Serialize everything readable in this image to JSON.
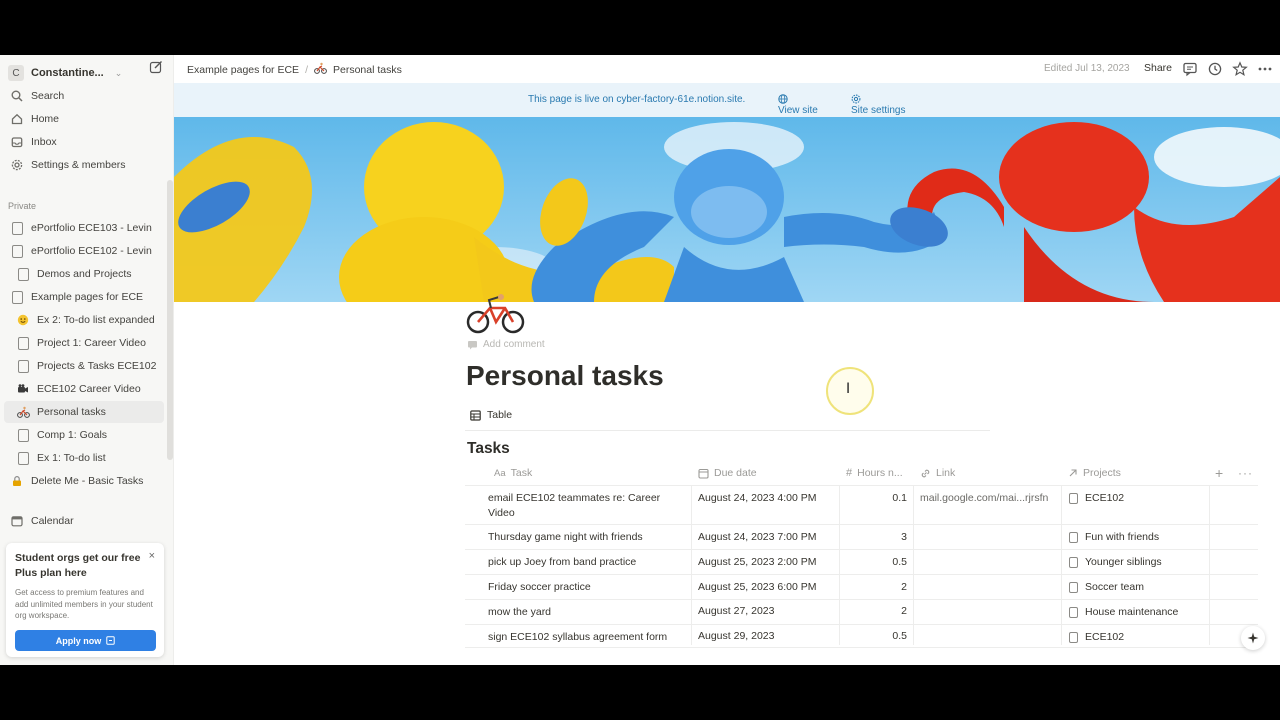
{
  "workspace": {
    "initial": "C",
    "name": "Constantine..."
  },
  "sidebar": {
    "top_items": [
      {
        "label": "Search",
        "icon": "search-icon"
      },
      {
        "label": "Home",
        "icon": "home-icon"
      },
      {
        "label": "Inbox",
        "icon": "inbox-icon"
      },
      {
        "label": "Settings & members",
        "icon": "gear-icon"
      }
    ],
    "section_label": "Private",
    "pages": [
      {
        "label": "ePortfolio ECE103 - Levin",
        "icon": "page-icon"
      },
      {
        "label": "ePortfolio ECE102 - Levin",
        "icon": "page-icon"
      },
      {
        "label": "Demos and Projects",
        "icon": "page-icon"
      },
      {
        "label": "Example pages for ECE",
        "icon": "page-icon"
      },
      {
        "label": "Ex 2: To-do list expanded",
        "icon": "smiley-icon"
      },
      {
        "label": "Project 1: Career Video",
        "icon": "page-icon"
      },
      {
        "label": "Projects & Tasks ECE102",
        "icon": "page-icon"
      },
      {
        "label": "ECE102 Career Video",
        "icon": "video-camera-icon"
      },
      {
        "label": "Personal tasks",
        "icon": "bicycle-icon"
      },
      {
        "label": "Comp 1: Goals",
        "icon": "page-icon"
      },
      {
        "label": "Ex 1: To-do list",
        "icon": "page-icon"
      },
      {
        "label": "Delete Me - Basic Tasks",
        "icon": "lock-icon"
      }
    ],
    "calendar_label": "Calendar"
  },
  "promo": {
    "title": "Student orgs get our free Plus plan here",
    "description": "Get access to premium features and add unlimited members in your student org workspace.",
    "button_label": "Apply now",
    "close": "×"
  },
  "topbar": {
    "breadcrumb_parent": "Example pages for ECE",
    "breadcrumb_separator": "/",
    "breadcrumb_current": "Personal tasks",
    "edited": "Edited Jul 13, 2023",
    "share_label": "Share"
  },
  "banner": {
    "message": "This page is live on cyber-factory-61e.notion.site.",
    "view_site": "View site",
    "site_settings": "Site settings"
  },
  "page": {
    "add_comment": "Add comment",
    "title": "Personal tasks",
    "view_tab": "Table",
    "database_title": "Tasks"
  },
  "table": {
    "columns": [
      "Task",
      "Due date",
      "Hours n...",
      "Link",
      "Projects"
    ],
    "header_prefix": "Aa",
    "rows": [
      {
        "task": "email ECE102 teammates re: Career Video",
        "due": "August 24, 2023 4:00 PM",
        "hours": "0.1",
        "link": "mail.google.com/mai...rjrsfn",
        "project": "ECE102"
      },
      {
        "task": "Thursday game night with friends",
        "due": "August 24, 2023 7:00 PM",
        "hours": "3",
        "link": "",
        "project": "Fun with friends"
      },
      {
        "task": "pick up Joey from band practice",
        "due": "August 25, 2023 2:00 PM",
        "hours": "0.5",
        "link": "",
        "project": "Younger siblings"
      },
      {
        "task": "Friday soccer practice",
        "due": "August 25, 2023 6:00 PM",
        "hours": "2",
        "link": "",
        "project": "Soccer team"
      },
      {
        "task": "mow the yard",
        "due": "August 27, 2023",
        "hours": "2",
        "link": "",
        "project": "House maintenance"
      },
      {
        "task": "sign ECE102 syllabus agreement form",
        "due": "August 29, 2023",
        "hours": "0.5",
        "link": "",
        "project": "ECE102"
      }
    ]
  },
  "colors": {
    "accent_blue": "#2f80e4",
    "banner_bg": "#e9f3fa",
    "banner_text": "#2a7ab0",
    "sidebar_bg": "#f7f7f5"
  }
}
